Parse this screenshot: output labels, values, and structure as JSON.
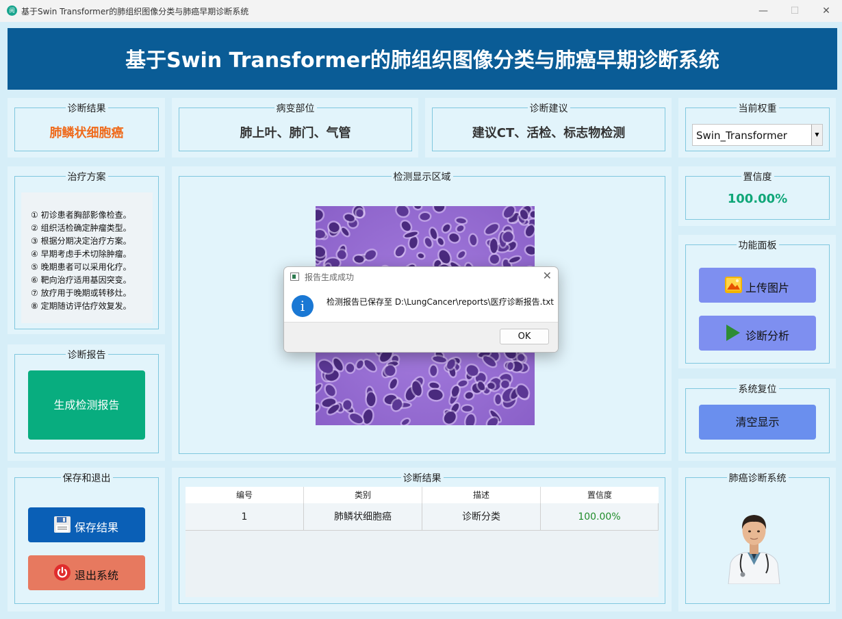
{
  "window": {
    "title": "基于Swin Transformer的肺组织图像分类与肺癌早期诊断系统",
    "app_icon_text": "阅",
    "controls": {
      "minimize": "—",
      "maximize": "☐",
      "close": "✕"
    }
  },
  "header": {
    "title": "基于Swin Transformer的肺组织图像分类与肺癌早期诊断系统"
  },
  "diagnosis_result": {
    "label": "诊断结果",
    "value": "肺鳞状细胞癌"
  },
  "lesion_site": {
    "label": "病变部位",
    "value": "肺上叶、肺门、气管"
  },
  "advice": {
    "label": "诊断建议",
    "value": "建议CT、活检、标志物检测"
  },
  "weights": {
    "label": "当前权重",
    "selected": "Swin_Transformer"
  },
  "treatment": {
    "label": "治疗方案",
    "items": [
      "① 初诊患者胸部影像检查。",
      "② 组织活检确定肿瘤类型。",
      "③ 根据分期决定治疗方案。",
      "④ 早期考虑手术切除肿瘤。",
      "⑤ 晚期患者可以采用化疗。",
      "⑥ 靶向治疗适用基因突变。",
      "⑦ 放疗用于晚期或转移灶。",
      "⑧ 定期随访评估疗效复发。"
    ]
  },
  "detection_area": {
    "label": "检测显示区域"
  },
  "confidence": {
    "label": "置信度",
    "value": "100.00%"
  },
  "function_panel": {
    "label": "功能面板",
    "upload_button": "上传图片",
    "analyze_button": "诊断分析"
  },
  "report": {
    "label": "诊断报告",
    "generate_button": "生成检测报告"
  },
  "reset": {
    "label": "系统复位",
    "clear_button": "清空显示"
  },
  "save_exit": {
    "label": "保存和退出",
    "save_button": "保存结果",
    "exit_button": "退出系统"
  },
  "results_table": {
    "label": "诊断结果",
    "columns": [
      "编号",
      "类别",
      "描述",
      "置信度"
    ],
    "rows": [
      [
        "1",
        "肺鳞状细胞癌",
        "诊断分类",
        "100.00%"
      ]
    ]
  },
  "system_card": {
    "label": "肺癌诊断系统"
  },
  "dialog": {
    "title": "报告生成成功",
    "message": "检测报告已保存至 D:\\LungCancer\\reports\\医疗诊断报告.txt",
    "ok_button": "OK",
    "close": "✕",
    "info_glyph": "i"
  },
  "colors": {
    "header_bg": "#0a5c96",
    "result_text": "#ef6a1b",
    "confidence_text": "#0fa678",
    "function_button_bg": "#7e8ff0",
    "report_button_bg": "#08ad7f",
    "clear_button_bg": "#6a8fee",
    "save_button_bg": "#0a5fb6",
    "exit_button_bg": "#e7795f",
    "table_confidence_text": "#1f8c2a",
    "panel_bg": "#e2f4fb",
    "panel_border": "#7fc7de"
  }
}
